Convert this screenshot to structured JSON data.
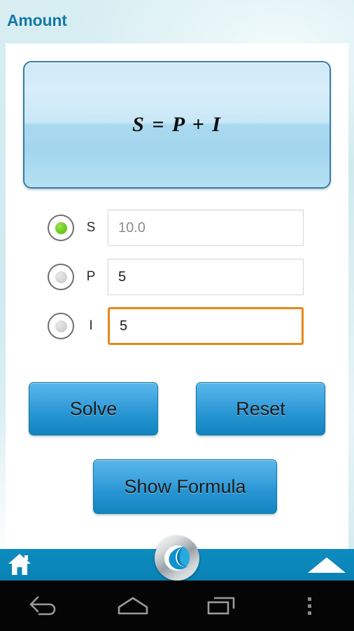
{
  "header": {
    "title": "Amount"
  },
  "formula": {
    "text": "S = P + I",
    "icon": "formula-panel"
  },
  "rows": [
    {
      "id": "S",
      "label": "S",
      "value": "10.0",
      "selected": true,
      "is_placeholder": true,
      "focused": false
    },
    {
      "id": "P",
      "label": "P",
      "value": "5",
      "selected": false,
      "is_placeholder": false,
      "focused": false
    },
    {
      "id": "I",
      "label": "I",
      "value": "5",
      "selected": false,
      "is_placeholder": false,
      "focused": true
    }
  ],
  "buttons": {
    "solve": "Solve",
    "reset": "Reset",
    "show_formula": "Show Formula"
  },
  "app_bar": {
    "home_icon": "home-icon",
    "logo_icon": "crescent-moon-logo",
    "expand_icon": "up-arrow-icon"
  },
  "nav_bar": {
    "back_icon": "back-icon",
    "home_icon": "android-home-icon",
    "recents_icon": "recent-apps-icon",
    "menu_icon": "overflow-menu-icon"
  },
  "colors": {
    "accent_blue": "#0a82b4",
    "title_blue": "#1278a8",
    "button_blue": "#2694d2",
    "focus_orange": "#e8871a",
    "radio_green": "#6fcc21",
    "background": "#cfe9ee"
  }
}
